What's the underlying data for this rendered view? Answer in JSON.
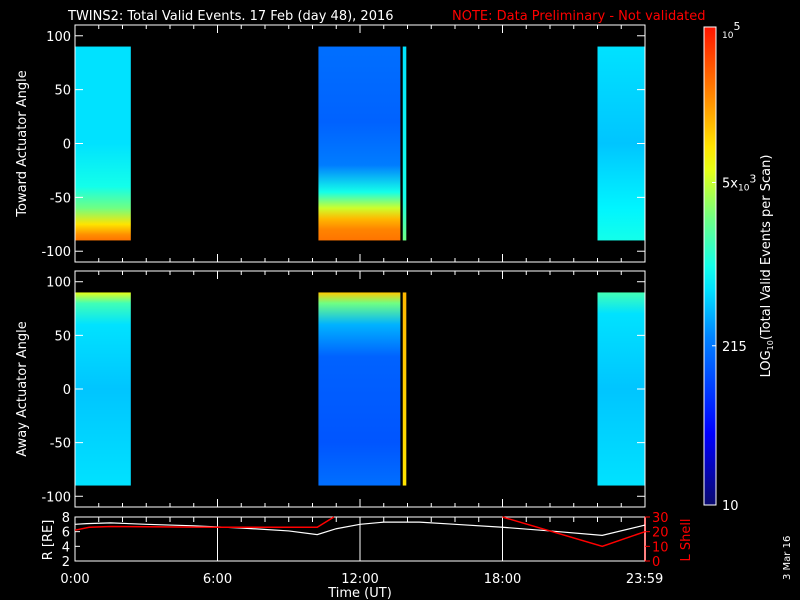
{
  "chart_data": {
    "type": "heatmap",
    "title": "TWINS2: Total Valid Events. 17 Feb (day  48), 2016",
    "note": "NOTE: Data Preliminary - Not validated",
    "date_stamp": "3 Mar 16",
    "xlabel": "Time (UT)",
    "x_ticks": [
      "0:00",
      "6:00",
      "12:00",
      "18:00",
      "23:59"
    ],
    "x_tick_hours": [
      0,
      6,
      12,
      18,
      23.983
    ],
    "xlim": [
      0,
      24
    ],
    "panels": [
      {
        "ylabel": "Toward Actuator Angle",
        "ylim": [
          -110,
          110
        ],
        "y_ticks": [
          "100",
          "50",
          "0",
          "-50",
          "-100"
        ],
        "y_tick_values": [
          100,
          50,
          0,
          -50,
          -100
        ],
        "data_range_deg": [
          -90,
          90
        ],
        "segments": [
          {
            "start_h": 0.0,
            "end_h": 2.35,
            "profile": [
              [
                90,
                0.45
              ],
              [
                0,
                0.45
              ],
              [
                -40,
                0.5
              ],
              [
                -60,
                0.6
              ],
              [
                -75,
                0.75
              ],
              [
                -85,
                0.85
              ],
              [
                -90,
                0.88
              ]
            ]
          },
          {
            "start_h": 10.25,
            "end_h": 13.7,
            "profile": [
              [
                90,
                0.32
              ],
              [
                20,
                0.3
              ],
              [
                -20,
                0.34
              ],
              [
                -45,
                0.5
              ],
              [
                -60,
                0.68
              ],
              [
                -70,
                0.8
              ],
              [
                -80,
                0.86
              ],
              [
                -90,
                0.88
              ]
            ]
          },
          {
            "start_h": 13.8,
            "end_h": 13.95,
            "profile": [
              [
                90,
                0.45
              ],
              [
                -50,
                0.5
              ],
              [
                -90,
                0.6
              ]
            ]
          },
          {
            "start_h": 22.0,
            "end_h": 24.0,
            "profile": [
              [
                90,
                0.45
              ],
              [
                0,
                0.42
              ],
              [
                -60,
                0.47
              ],
              [
                -90,
                0.5
              ]
            ]
          }
        ]
      },
      {
        "ylabel": "Away Actuator Angle",
        "ylim": [
          -110,
          110
        ],
        "y_ticks": [
          "100",
          "50",
          "0",
          "-50",
          "-100"
        ],
        "y_tick_values": [
          100,
          50,
          0,
          -50,
          -100
        ],
        "data_range_deg": [
          -90,
          90
        ],
        "segments": [
          {
            "start_h": 0.0,
            "end_h": 2.35,
            "profile": [
              [
                90,
                0.7
              ],
              [
                80,
                0.55
              ],
              [
                60,
                0.45
              ],
              [
                0,
                0.42
              ],
              [
                -90,
                0.45
              ]
            ]
          },
          {
            "start_h": 10.25,
            "end_h": 13.7,
            "profile": [
              [
                90,
                0.78
              ],
              [
                80,
                0.6
              ],
              [
                60,
                0.4
              ],
              [
                30,
                0.3
              ],
              [
                -50,
                0.28
              ],
              [
                -90,
                0.32
              ]
            ]
          },
          {
            "start_h": 13.8,
            "end_h": 13.95,
            "profile": [
              [
                90,
                0.8
              ],
              [
                -90,
                0.75
              ]
            ]
          },
          {
            "start_h": 22.0,
            "end_h": 24.0,
            "profile": [
              [
                90,
                0.55
              ],
              [
                70,
                0.45
              ],
              [
                0,
                0.42
              ],
              [
                -90,
                0.45
              ]
            ]
          }
        ]
      }
    ],
    "colorbar": {
      "label": "LOG10(Total Valid Events per Scan)",
      "label_main": "LOG",
      "label_sub": "10",
      "label_rest": "(Total Valid Events per Scan)",
      "min": 10,
      "max": 100000,
      "ticks": [
        {
          "label": "10",
          "value": 10
        },
        {
          "label": "215",
          "value": 215
        },
        {
          "label": "5x10",
          "sup": "3",
          "value": 5000
        },
        {
          "label": "10",
          "sup": "5",
          "value": 100000
        }
      ]
    },
    "orbit_panel": {
      "left_label": "R [RE]",
      "left_ticks": [
        "2",
        "4",
        "6",
        "8"
      ],
      "left_tick_values": [
        2,
        4,
        6,
        8
      ],
      "left_ylim": [
        2,
        8
      ],
      "right_label": "L Shell",
      "right_ticks": [
        "0",
        "10",
        "20",
        "30"
      ],
      "right_tick_values": [
        0,
        10,
        20,
        30
      ],
      "right_ylim": [
        0,
        30
      ],
      "right_color": "#ff0000",
      "R_series": [
        [
          0,
          7.0
        ],
        [
          0.5,
          7.1
        ],
        [
          1.5,
          7.2
        ],
        [
          3,
          7.0
        ],
        [
          5,
          6.8
        ],
        [
          7,
          6.5
        ],
        [
          9,
          6.1
        ],
        [
          10.2,
          5.6
        ],
        [
          11,
          6.4
        ],
        [
          12,
          7.0
        ],
        [
          13,
          7.3
        ],
        [
          14.5,
          7.3
        ],
        [
          16,
          7.0
        ],
        [
          18,
          6.6
        ],
        [
          20,
          6.1
        ],
        [
          22.2,
          5.5
        ],
        [
          24,
          6.9
        ]
      ],
      "L_series": [
        [
          [
            0,
            21
          ],
          [
            0.6,
            23
          ],
          [
            1.5,
            23.5
          ],
          [
            6,
            23
          ],
          [
            10.2,
            23
          ],
          [
            10.9,
            30
          ]
        ],
        [
          [
            18,
            30
          ],
          [
            22.2,
            10
          ],
          [
            24,
            20
          ]
        ]
      ]
    }
  }
}
